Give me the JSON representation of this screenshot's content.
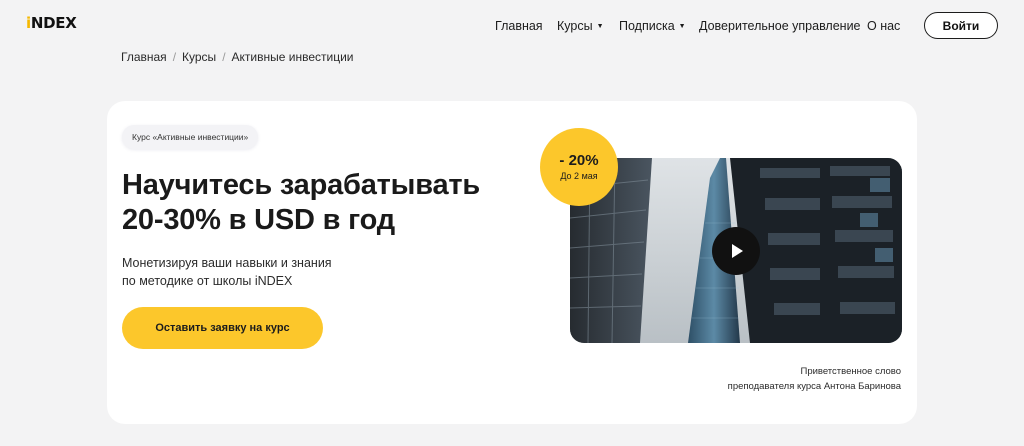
{
  "header": {
    "logo": {
      "accent": "i",
      "rest": "NDEX",
      "accent_color": "#f5b800"
    },
    "nav": [
      {
        "label": "Главная",
        "has_dropdown": false
      },
      {
        "label": "Курсы",
        "has_dropdown": true
      },
      {
        "label": "Подписка",
        "has_dropdown": true
      },
      {
        "label": "Доверительное управление",
        "has_dropdown": false
      },
      {
        "label": "О нас",
        "has_dropdown": false
      }
    ],
    "login_label": "Войти"
  },
  "breadcrumb": [
    "Главная",
    "Курсы",
    "Активные инвестиции"
  ],
  "hero": {
    "chip": "Курс «Активные инвестиции»",
    "title_line1": "Научитесь зарабатывать",
    "title_line2": "20-30% в USD в год",
    "subtitle_line1": "Монетизируя ваши навыки и знания",
    "subtitle_line2": "по методике от школы iNDEX",
    "cta_label": "Оставить заявку на курс",
    "discount": {
      "percent": "- 20%",
      "until": "До 2 мая"
    },
    "video_caption_line1": "Приветственное слово",
    "video_caption_line2": "преподавателя курса Антона Баринова"
  },
  "colors": {
    "accent": "#fcc72b",
    "background": "#f3f3f4",
    "card": "#ffffff",
    "text": "#1c1c1c"
  },
  "icons": {
    "play": "play-icon",
    "caret": "caret-down-icon"
  }
}
